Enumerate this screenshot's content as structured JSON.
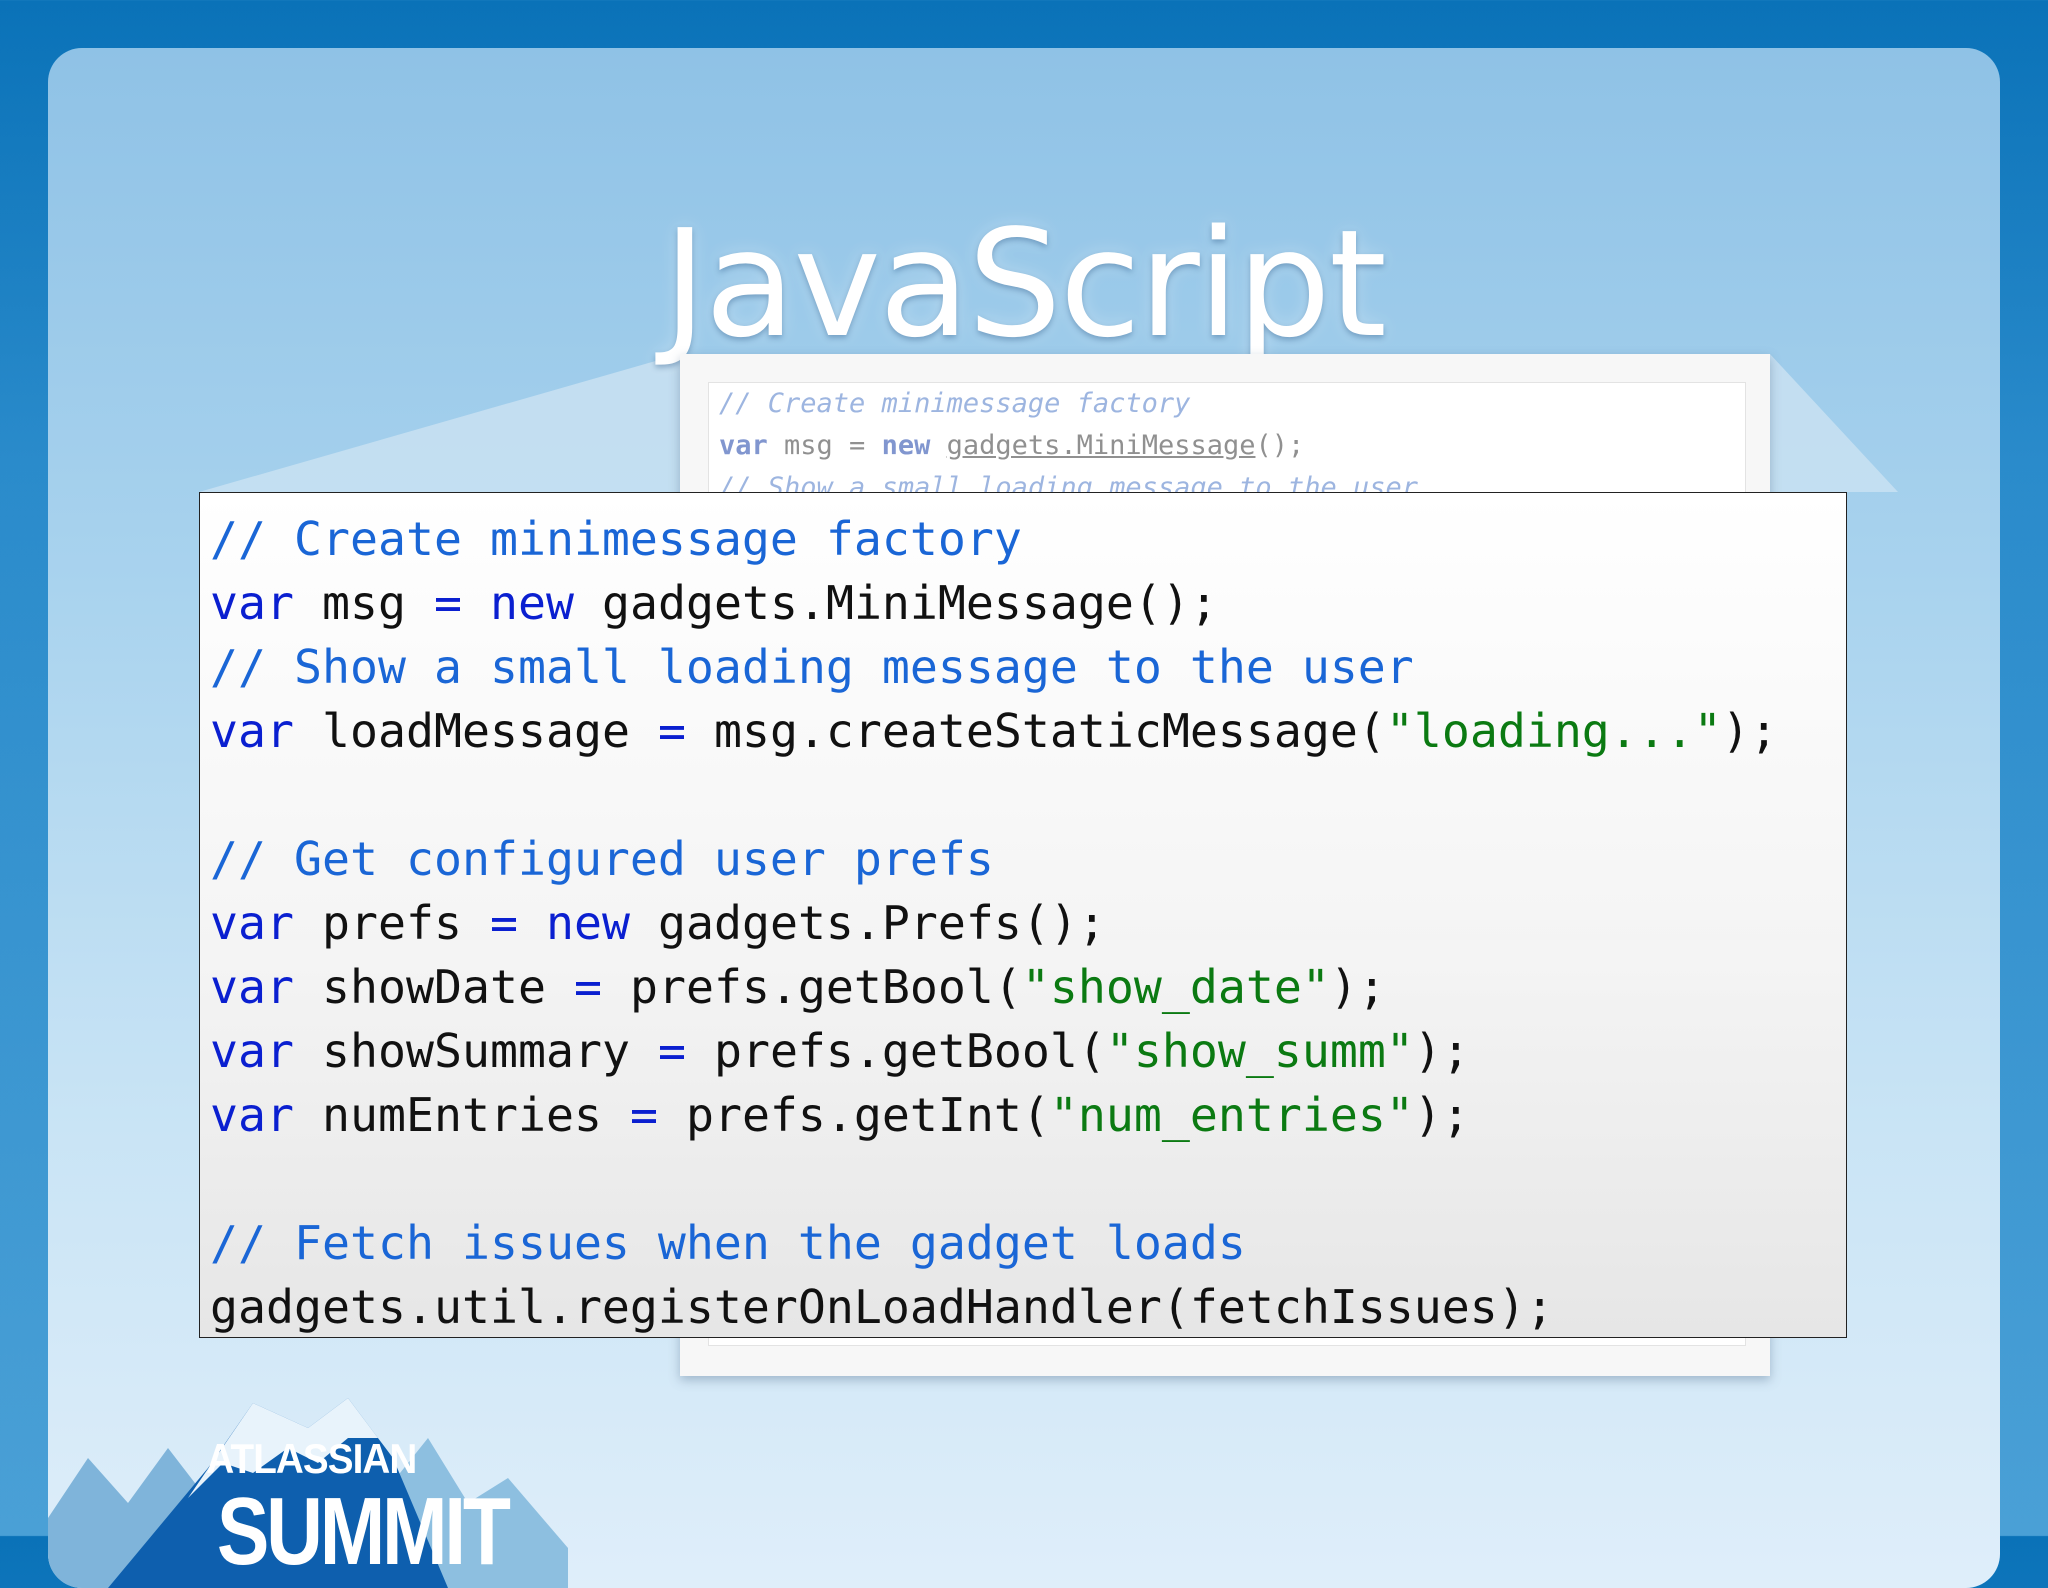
{
  "slide": {
    "title": "JavaScript"
  },
  "background_screenshot": {
    "lines": [
      {
        "comment": "// Create minimessage factory"
      },
      {
        "kw": "var",
        "name": " msg = ",
        "kw2": "new",
        "call": "gadgets.MiniMessage",
        "tail": "();"
      },
      {
        "comment": "// Show a small loading message to the user"
      }
    ]
  },
  "code": {
    "lines": [
      [
        {
          "t": "cm",
          "v": "// Create minimessage factory"
        }
      ],
      [
        {
          "t": "kw",
          "v": "var"
        },
        {
          "t": "tx",
          "v": " msg "
        },
        {
          "t": "kw",
          "v": "="
        },
        {
          "t": "tx",
          "v": " "
        },
        {
          "t": "kw",
          "v": "new"
        },
        {
          "t": "tx",
          "v": " gadgets.MiniMessage();"
        }
      ],
      [
        {
          "t": "cm",
          "v": "// Show a small loading message to the user"
        }
      ],
      [
        {
          "t": "kw",
          "v": "var"
        },
        {
          "t": "tx",
          "v": " loadMessage "
        },
        {
          "t": "kw",
          "v": "="
        },
        {
          "t": "tx",
          "v": " msg.createStaticMessage("
        },
        {
          "t": "st",
          "v": "\"loading...\""
        },
        {
          "t": "tx",
          "v": ");"
        }
      ],
      [],
      [
        {
          "t": "cm",
          "v": "// Get configured user prefs"
        }
      ],
      [
        {
          "t": "kw",
          "v": "var"
        },
        {
          "t": "tx",
          "v": " prefs "
        },
        {
          "t": "kw",
          "v": "="
        },
        {
          "t": "tx",
          "v": " "
        },
        {
          "t": "kw",
          "v": "new"
        },
        {
          "t": "tx",
          "v": " gadgets.Prefs();"
        }
      ],
      [
        {
          "t": "kw",
          "v": "var"
        },
        {
          "t": "tx",
          "v": " showDate "
        },
        {
          "t": "kw",
          "v": "="
        },
        {
          "t": "tx",
          "v": " prefs.getBool("
        },
        {
          "t": "st",
          "v": "\"show_date\""
        },
        {
          "t": "tx",
          "v": ");"
        }
      ],
      [
        {
          "t": "kw",
          "v": "var"
        },
        {
          "t": "tx",
          "v": " showSummary "
        },
        {
          "t": "kw",
          "v": "="
        },
        {
          "t": "tx",
          "v": " prefs.getBool("
        },
        {
          "t": "st",
          "v": "\"show_summ\""
        },
        {
          "t": "tx",
          "v": ");"
        }
      ],
      [
        {
          "t": "kw",
          "v": "var"
        },
        {
          "t": "tx",
          "v": " numEntries "
        },
        {
          "t": "kw",
          "v": "="
        },
        {
          "t": "tx",
          "v": " prefs.getInt("
        },
        {
          "t": "st",
          "v": "\"num_entries\""
        },
        {
          "t": "tx",
          "v": ");"
        }
      ],
      [],
      [
        {
          "t": "cm",
          "v": "// Fetch issues when the gadget loads"
        }
      ],
      [
        {
          "t": "tx",
          "v": "gadgets.util.registerOnLoadHandler(fetchIssues);"
        }
      ]
    ]
  },
  "logo": {
    "top": "ATLASSIAN",
    "bottom": "SUMMIT"
  },
  "colors": {
    "keyword": "#0a1fd0",
    "comment": "#1a66d6",
    "string": "#0b7a12",
    "text": "#111111"
  }
}
